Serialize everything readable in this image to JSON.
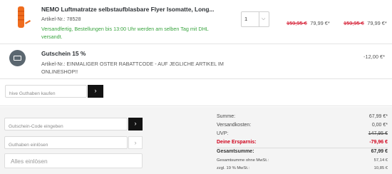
{
  "product": {
    "title": "NEMO Luftmatratze selbstaufblasbare Flyer Isomatte, Long...",
    "article": "Artikel-Nr.: 78528",
    "shipping": "Versandfertig, Bestellungen bis 13:00 Uhr werden am selben Tag mit DHL versandt.",
    "quantity": "1",
    "unit_price_old": "159,95 €",
    "unit_price": "79,99 €*",
    "total_price_old": "159,95 €",
    "total_price": "79,99 €*",
    "thumb_icon": "orange-sleeping-pad"
  },
  "voucher": {
    "icon": "voucher-card-icon",
    "title": "Gutschein 15 %",
    "article": "Artikel-Nr.: EINMALIGER OSTER RABATTCODE - AUF JEGLICHE ARTIKEL IM ONLINESHOP!!",
    "price": "-12,00 €*"
  },
  "gift_card": {
    "placeholder": "hive Guthaben kaufen",
    "button": "›"
  },
  "coupon": {
    "placeholder": "Gutschein-Code eingeben",
    "button": "›"
  },
  "credit": {
    "placeholder": "Guthaben einlösen",
    "button": "›"
  },
  "redeem_all": "Alles einlösen",
  "summary": {
    "sum_label": "Summe:",
    "sum_value": "67,99 €*",
    "shipping_label": "Versandkosten:",
    "shipping_value": "0,00 €*",
    "uvp_label": "UVP:",
    "uvp_value": "147,95 €",
    "savings_label": "Deine Ersparnis:",
    "savings_value": "-79,96 €",
    "total_label": "Gesamtsumme:",
    "total_value": "67,99 €",
    "net_label": "Gesamtsumme ohne MwSt.:",
    "net_value": "57,14 €",
    "vat_label": "zzgl. 19 % MwSt.:",
    "vat_value": "10,85 €"
  },
  "colors": {
    "accent_red": "#d0021b",
    "green": "#3aa540",
    "dark": "#131313",
    "orange": "#ef6c1e"
  }
}
